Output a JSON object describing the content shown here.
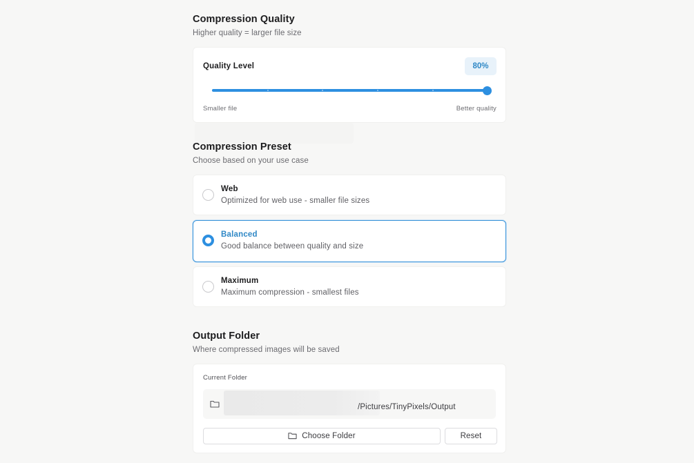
{
  "quality": {
    "title": "Compression Quality",
    "subtitle": "Higher quality = larger file size",
    "level_label": "Quality Level",
    "value_display": "80%",
    "slider_value_percent": 100,
    "min_label": "Smaller file",
    "max_label": "Better quality"
  },
  "preset": {
    "title": "Compression Preset",
    "subtitle": "Choose based on your use case",
    "options": [
      {
        "name": "Web",
        "description": "Optimized for web use - smaller file sizes",
        "selected": false
      },
      {
        "name": "Balanced",
        "description": "Good balance between quality and size",
        "selected": true
      },
      {
        "name": "Maximum",
        "description": "Maximum compression - smallest files",
        "selected": false
      }
    ]
  },
  "output": {
    "title": "Output Folder",
    "subtitle": "Where compressed images will be saved",
    "current_label": "Current Folder",
    "path": "/Pictures/TinyPixels/Output",
    "choose_label": "Choose Folder",
    "reset_label": "Reset"
  },
  "colors": {
    "accent": "#2d8fe0",
    "accent_text": "#2f88c6",
    "badge_bg": "#e8f2fa",
    "page_bg": "#f7f7f6"
  },
  "icons": {
    "folder": "folder-icon"
  }
}
